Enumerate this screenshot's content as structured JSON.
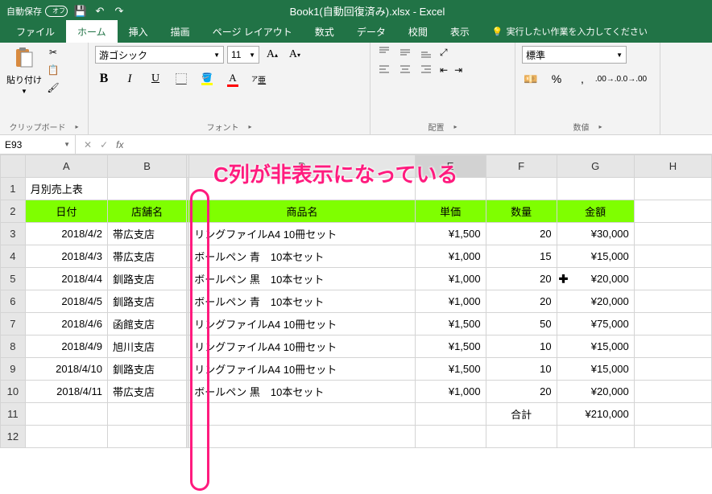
{
  "titlebar": {
    "autosave_label": "自動保存",
    "autosave_state": "オフ",
    "title": "Book1(自動回復済み).xlsx - Excel"
  },
  "tabs": {
    "file": "ファイル",
    "home": "ホーム",
    "insert": "挿入",
    "draw": "描画",
    "pagelayout": "ページ レイアウト",
    "formulas": "数式",
    "data": "データ",
    "review": "校閲",
    "view": "表示",
    "tellme": "実行したい作業を入力してください"
  },
  "ribbon": {
    "clipboard": {
      "paste": "貼り付け",
      "label": "クリップボード"
    },
    "font": {
      "name": "游ゴシック",
      "size": "11",
      "label": "フォント"
    },
    "alignment": {
      "label": "配置"
    },
    "number": {
      "format": "標準",
      "label": "数値"
    }
  },
  "formula": {
    "cell_ref": "E93"
  },
  "annotation": "C列が非表示になっている",
  "columns": {
    "A": "A",
    "B": "B",
    "D": "D",
    "E": "E",
    "F": "F",
    "G": "G",
    "H": "H"
  },
  "data": {
    "title": "月別売上表",
    "headers": {
      "date": "日付",
      "store": "店舗名",
      "product": "商品名",
      "price": "単価",
      "qty": "数量",
      "amount": "金額"
    },
    "rows": [
      {
        "r": "3",
        "date": "2018/4/2",
        "store": "帯広支店",
        "product": "リングファイルA4 10冊セット",
        "price": "¥1,500",
        "qty": "20",
        "amount": "¥30,000"
      },
      {
        "r": "4",
        "date": "2018/4/3",
        "store": "帯広支店",
        "product": "ボールペン 青　10本セット",
        "price": "¥1,000",
        "qty": "15",
        "amount": "¥15,000"
      },
      {
        "r": "5",
        "date": "2018/4/4",
        "store": "釧路支店",
        "product": "ボールペン 黒　10本セット",
        "price": "¥1,000",
        "qty": "20",
        "amount": "¥20,000"
      },
      {
        "r": "6",
        "date": "2018/4/5",
        "store": "釧路支店",
        "product": "ボールペン 青　10本セット",
        "price": "¥1,000",
        "qty": "20",
        "amount": "¥20,000"
      },
      {
        "r": "7",
        "date": "2018/4/6",
        "store": "函館支店",
        "product": "リングファイルA4 10冊セット",
        "price": "¥1,500",
        "qty": "50",
        "amount": "¥75,000"
      },
      {
        "r": "8",
        "date": "2018/4/9",
        "store": "旭川支店",
        "product": "リングファイルA4 10冊セット",
        "price": "¥1,500",
        "qty": "10",
        "amount": "¥15,000"
      },
      {
        "r": "9",
        "date": "2018/4/10",
        "store": "釧路支店",
        "product": "リングファイルA4 10冊セット",
        "price": "¥1,500",
        "qty": "10",
        "amount": "¥15,000"
      },
      {
        "r": "10",
        "date": "2018/4/11",
        "store": "帯広支店",
        "product": "ボールペン 黒　10本セット",
        "price": "¥1,000",
        "qty": "20",
        "amount": "¥20,000"
      }
    ],
    "total_label": "合計",
    "total_amount": "¥210,000"
  }
}
